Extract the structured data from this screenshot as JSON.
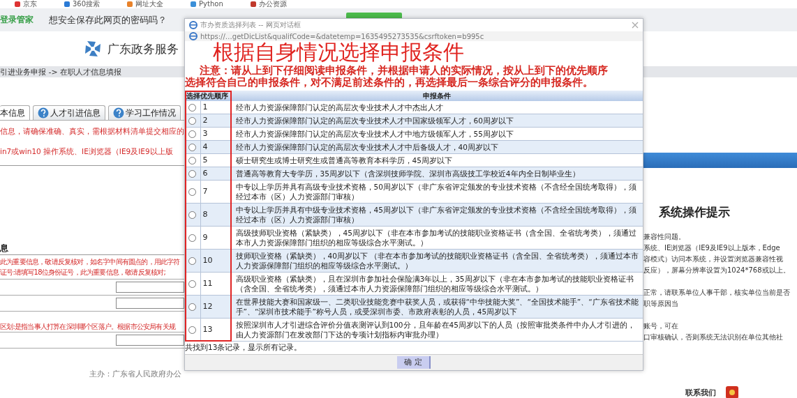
{
  "bookmarks": [
    {
      "label": "京东"
    },
    {
      "label": "360搜索"
    },
    {
      "label": "网址大全"
    },
    {
      "label": "Python"
    },
    {
      "label": "办公资源"
    }
  ],
  "password_bar": {
    "brand": "登录管家",
    "prompt": "想安全保存此网页的密码吗？"
  },
  "page": {
    "site_title": "广东政务服务",
    "breadcrumb": "引进业务申报 -> 在职人才信息填报",
    "tabs": [
      {
        "label": "本信息",
        "selected": true
      },
      {
        "label": "人才引进信息",
        "selected": false
      },
      {
        "label": "学习工作情况",
        "selected": false
      }
    ],
    "notices": [
      "信息，请确保准确、真实，需根据材料清单提交相应的",
      "in7或win10 操作系统、IE浏览器（IE9及IE9以上版"
    ],
    "section_title": "息",
    "section_notes": [
      "此为重要信息，敬请反复核对，如名字中间有圆点的，用此字符",
      "证号:请填写18位身份证号，此为重要信息，敬请反复核对;"
    ],
    "district_note": "区划:是指当事人打算在深圳哪个区落户。根据市公安局有关规",
    "footer": "主办：广东省人民政府办公"
  },
  "tips_panel": {
    "title": "系统操作提示",
    "paragraphs": [
      [
        "兼容性问题。",
        "系统、IE浏览器（IE9及IE9以上版本，Edge",
        "容模式）访问本系统，并设置浏览器兼容性视",
        "反应），屏幕分辨率设置为1024*768或以上。"
      ],
      [
        "正常，请联系单位人事干部，核实单位当前是否",
        "职等原因当"
      ],
      [
        "账号，可在",
        "口审核确认，否则系统无法识别在单位其他社"
      ]
    ],
    "contact": "联系我们"
  },
  "dialog": {
    "title": "市办资质选择列表 -- 网页对话框",
    "url": "https://…getDicList&qualifCode=&datetemp=1635495273535&csrftoken=b995c",
    "annotation_title": "根据自身情况选择申报条件",
    "notice_lines": [
      "注意：请从上到下仔细阅读申报条件，并根据申请人的实际情况，按从上到下的优先顺序",
      "选择符合自己的申报条件，对不满足前述条件的，再选择最后一条综合评分的申报条件。"
    ],
    "columns": [
      "选择",
      "优先顺序",
      "申报条件"
    ],
    "rows": [
      {
        "selected": false,
        "order": "1",
        "condition": "经市人力资源保障部门认定的高层次专业技术人才中杰出人才"
      },
      {
        "selected": false,
        "order": "2",
        "condition": "经市人力资源保障部门认定的高层次专业技术人才中国家级领军人才，60周岁以下"
      },
      {
        "selected": false,
        "order": "3",
        "condition": "经市人力资源保障部门认定的高层次专业技术人才中地方级领军人才，55周岁以下"
      },
      {
        "selected": false,
        "order": "4",
        "condition": "经市人力资源保障部门认定的高层次专业技术人才中后备级人才，40周岁以下"
      },
      {
        "selected": false,
        "order": "5",
        "condition": "硕士研究生或博士研究生或普通高等教育本科学历，45周岁以下"
      },
      {
        "selected": false,
        "order": "6",
        "condition": "普通高等教育大专学历，35周岁以下（含深圳技师学院、深圳市高级技工学校近4年内全日制毕业生）"
      },
      {
        "selected": false,
        "order": "7",
        "condition": "中专以上学历并具有高级专业技术资格，50周岁以下（非广东省评定颁发的专业技术资格（不含经全国统考取得），须经过本市（区）人力资源部门审核）"
      },
      {
        "selected": false,
        "order": "8",
        "condition": "中专以上学历并具有中级专业技术资格，45周岁以下（非广东省评定颁发的专业技术资格（不含经全国统考取得），须经过本市（区）人力资源部门审核）"
      },
      {
        "selected": false,
        "order": "9",
        "condition": "高级技师职业资格（紧缺类），45周岁以下（非在本市参加考试的技能职业资格证书（含全国、全省统考类），须通过本市人力资源保障部门组织的相应等级综合水平测试。）"
      },
      {
        "selected": false,
        "order": "10",
        "condition": "技师职业资格（紧缺类），40周岁以下 （非在本市参加考试的技能职业资格证书（含全国、全省统考类），须通过本市人力资源保障部门组织的相应等级综合水平测试。）"
      },
      {
        "selected": false,
        "order": "11",
        "condition": "高级职业资格（紧缺类），且在深圳市参加社会保险满3年以上，35周岁以下（非在本市参加考试的技能职业资格证书（含全国、全省统考类），须通过本市人力资源保障部门组织的相应等级综合水平测试。）"
      },
      {
        "selected": false,
        "order": "12",
        "condition": "在世界技能大赛和国家级一、二类职业技能竞赛中获奖人员，或获得“中华技能大奖”、“全国技术能手”、“广东省技术能手”、“深圳市技术能手”称号人员，或受深圳市委、市政府表彰的人员，45周岁以下"
      },
      {
        "selected": false,
        "order": "13",
        "condition": "按照深圳市人才引进综合评价分值表测评认到100分，且年龄在45周岁以下的人员（按照审批类条件中办人才引进的，由人力资源部门在发改部门下达的专项计划指标内审批办理）"
      }
    ],
    "footer_text": "共找到13条记录，显示所有记录。",
    "confirm_button": "确 定"
  }
}
